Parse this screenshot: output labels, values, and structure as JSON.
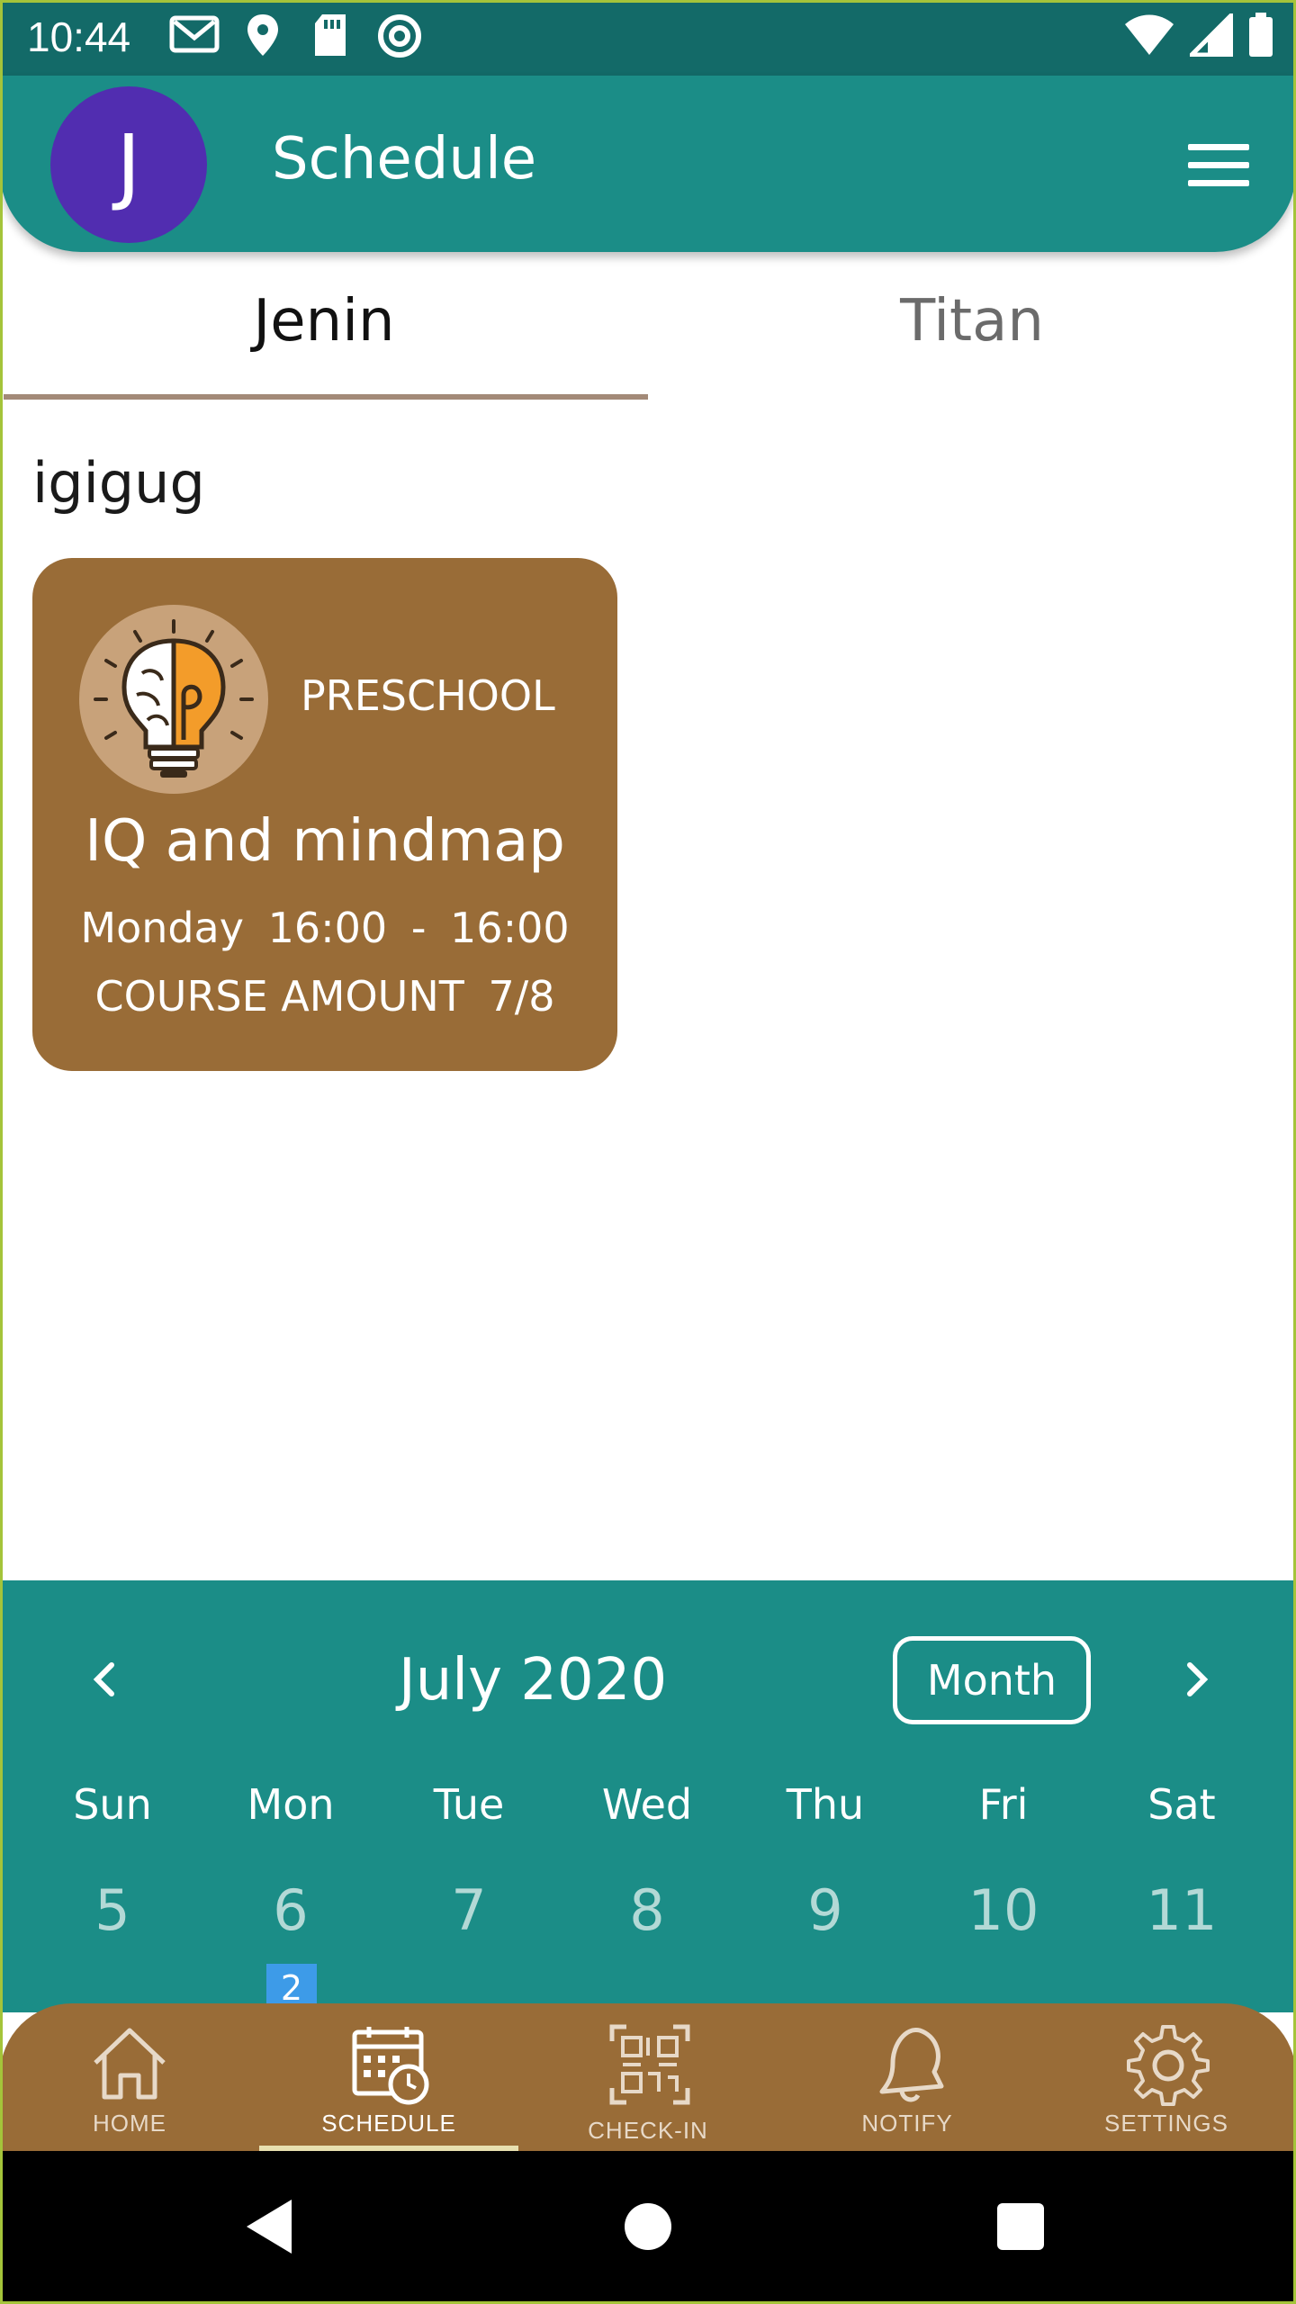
{
  "status_bar": {
    "time": "10:44",
    "left_icons": [
      "gmail-icon",
      "location-icon",
      "sd-card-icon",
      "at-sign-icon"
    ],
    "right_icons": [
      "wifi-icon",
      "signal-icon",
      "battery-icon"
    ]
  },
  "app_bar": {
    "avatar_letter": "J",
    "title": "Schedule",
    "menu_icon": "hamburger-menu-icon",
    "background": "#1b8d87",
    "avatar_color": "#512db0"
  },
  "tabs": [
    {
      "label": "Jenin",
      "selected": true
    },
    {
      "label": "Titan",
      "selected": false
    }
  ],
  "schedule": {
    "group_label": "igigug",
    "courses": [
      {
        "category": "PRESCHOOL",
        "name": "IQ and mindmap",
        "day": "Monday",
        "start": "16:00",
        "separator": "-",
        "end": "16:00",
        "amount_label": "COURSE AMOUNT",
        "amount": "7/8",
        "icon": "brain-lightbulb-icon",
        "color": "#996c37"
      }
    ]
  },
  "calendar": {
    "title": "July 2020",
    "mode_button": "Month",
    "prev_icon": "chevron-left-icon",
    "next_icon": "chevron-right-icon",
    "weekdays": [
      "Sun",
      "Mon",
      "Tue",
      "Wed",
      "Thu",
      "Fri",
      "Sat"
    ],
    "days": [
      "5",
      "6",
      "7",
      "8",
      "9",
      "10",
      "11"
    ],
    "event_badge": {
      "day": "6",
      "count": "2",
      "color": "#3d9be8"
    }
  },
  "bottom_nav": [
    {
      "label": "HOME",
      "icon": "home-icon",
      "active": false
    },
    {
      "label": "SCHEDULE",
      "icon": "calendar-clock-icon",
      "active": true
    },
    {
      "label": "CHECK-IN",
      "icon": "qr-code-icon",
      "active": false
    },
    {
      "label": "NOTIFY",
      "icon": "bell-icon",
      "active": false
    },
    {
      "label": "SETTINGS",
      "icon": "gear-icon",
      "active": false
    }
  ],
  "system_nav": [
    "back-icon",
    "home-circle-icon",
    "recents-icon"
  ]
}
